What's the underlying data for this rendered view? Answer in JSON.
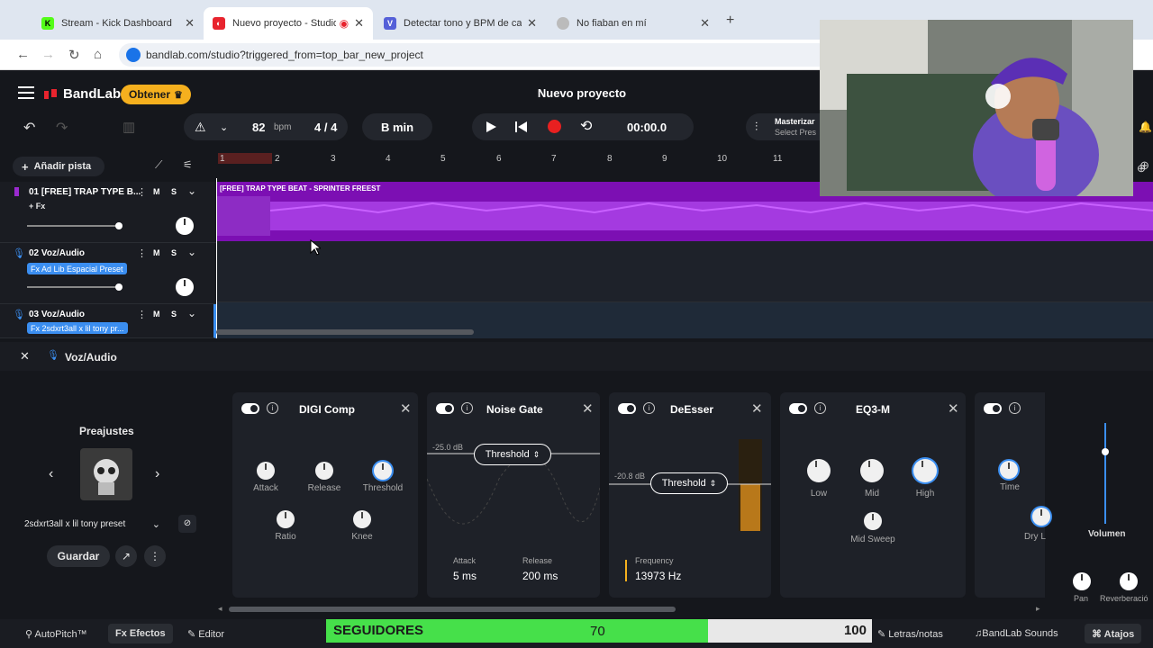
{
  "browser": {
    "tabs": [
      {
        "title": "Stream - Kick Dashboard",
        "icon": "kick-icon"
      },
      {
        "title": "Nuevo proyecto - Studio",
        "icon": "bandlab-icon"
      },
      {
        "title": "Detectar tono y BPM de canció",
        "icon": "vocal-site-icon"
      },
      {
        "title": "No fiaban en mí",
        "icon": "web-icon"
      }
    ],
    "url": "bandlab.com/studio?triggered_from=top_bar_new_project"
  },
  "app": {
    "brand": "BandLab",
    "get_button": "Obtener",
    "project_title": "Nuevo proyecto"
  },
  "toolbar": {
    "bpm": "82",
    "bpm_unit": "bpm",
    "time_sig": "4 / 4",
    "key": "B min",
    "time": "00:00.0",
    "master_label": "Masterizar",
    "master_sub": "Select Pres"
  },
  "tracks_header": {
    "add_track": "Añadir pista"
  },
  "ruler": [
    "1",
    "2",
    "3",
    "4",
    "5",
    "6",
    "7",
    "8",
    "9",
    "10",
    "11"
  ],
  "tracks": [
    {
      "name": "01  [FREE] TRAP TYPE B...",
      "fx": "+ Fx"
    },
    {
      "name": "02  Voz/Audio",
      "fx": "Fx  Ad Lib Espacial Preset"
    },
    {
      "name": "03  Voz/Audio",
      "fx": "Fx  2sdxrt3all x lil tony pr..."
    }
  ],
  "track_buttons": {
    "mute": "M",
    "solo": "S"
  },
  "region_title": "[FREE] TRAP TYPE BEAT - SPRINTER  FREEST",
  "panel": {
    "track_label": "Voz/Audio",
    "presets_title": "Preajustes",
    "preset_name": "2sdxrt3all x lil tony preset",
    "save": "Guardar"
  },
  "effects": {
    "comp": {
      "title": "DIGI Comp",
      "attack": "Attack",
      "release": "Release",
      "threshold": "Threshold",
      "ratio": "Ratio",
      "knee": "Knee"
    },
    "gate": {
      "title": "Noise Gate",
      "db": "-25.0 dB",
      "threshold": "Threshold",
      "attack_label": "Attack",
      "attack_val": "5 ms",
      "release_label": "Release",
      "release_val": "200 ms"
    },
    "deesser": {
      "title": "DeEsser",
      "db": "-20.8 dB",
      "threshold": "Threshold",
      "freq_label": "Frequency",
      "freq_val": "13973 Hz"
    },
    "eq": {
      "title": "EQ3-M",
      "low": "Low",
      "mid": "Mid",
      "high": "High",
      "sweep": "Mid Sweep"
    },
    "delay": {
      "time": "Time",
      "dry": "Dry L"
    }
  },
  "mixer": {
    "volume": "Volumen",
    "pan": "Pan",
    "reverb": "Reverberació"
  },
  "bottom": {
    "autopitch": "AutoPitch™",
    "effects": "Efectos",
    "editor": "Editor",
    "lyrics": "Letras/notas",
    "sounds": "BandLab Sounds",
    "shortcuts": "Atajos"
  },
  "followers": {
    "label": "SEGUIDORES",
    "current": "70",
    "goal": "100",
    "progress": 0.7
  },
  "colors": {
    "accent": "#f5b01e",
    "region": "#7c0fb3",
    "record": "#e82020",
    "fx_tag": "#3b8ef0",
    "followers_bar": "#46e04a"
  }
}
